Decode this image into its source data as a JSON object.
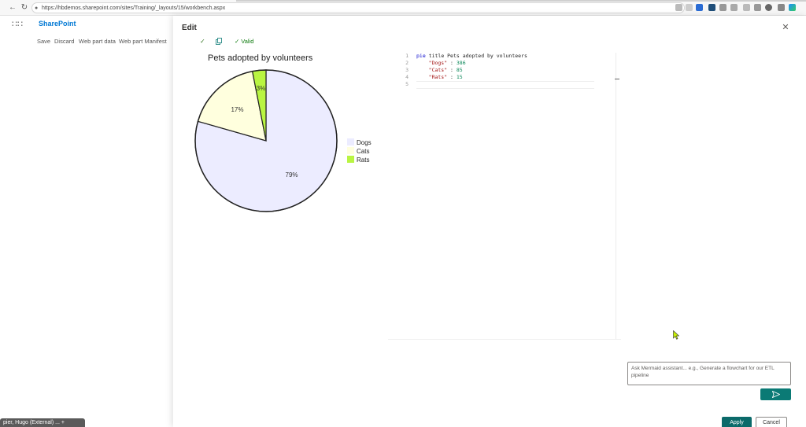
{
  "browser": {
    "url": "https://hbdemos.sharepoint.com/sites/Training/_layouts/15/workbench.aspx"
  },
  "sharepoint": {
    "brand": "SharePoint",
    "commands": [
      "Save",
      "Discard",
      "Web part data",
      "Web part Manifest"
    ],
    "taskbar_chip": "pier, Hugo (External)  ...  +"
  },
  "panel": {
    "title": "Edit",
    "valid_label": "Valid",
    "apply_label": "Apply",
    "cancel_label": "Cancel"
  },
  "editor": {
    "lines": [
      {
        "n": "1",
        "tokens": [
          {
            "t": "pie",
            "c": "kw"
          },
          {
            "t": " title Pets adopted by volunteers",
            "c": "plain"
          }
        ]
      },
      {
        "n": "2",
        "tokens": [
          {
            "t": "    ",
            "c": "plain"
          },
          {
            "t": "\"Dogs\"",
            "c": "str"
          },
          {
            "t": " : ",
            "c": "plain"
          },
          {
            "t": "386",
            "c": "num"
          }
        ]
      },
      {
        "n": "3",
        "tokens": [
          {
            "t": "    ",
            "c": "plain"
          },
          {
            "t": "\"Cats\"",
            "c": "str"
          },
          {
            "t": " : ",
            "c": "plain"
          },
          {
            "t": "85",
            "c": "num"
          }
        ]
      },
      {
        "n": "4",
        "tokens": [
          {
            "t": "    ",
            "c": "plain"
          },
          {
            "t": "\"Rats\"",
            "c": "str"
          },
          {
            "t": " : ",
            "c": "plain"
          },
          {
            "t": "15",
            "c": "num"
          }
        ]
      },
      {
        "n": "5",
        "tokens": []
      }
    ]
  },
  "assistant": {
    "placeholder": "Ask Mermaid assistant... e.g., Generate a flowchart for our ETL pipeline",
    "send_icon": "send-icon"
  },
  "chart_data": {
    "type": "pie",
    "title": "Pets adopted by volunteers",
    "categories": [
      "Dogs",
      "Cats",
      "Rats"
    ],
    "values": [
      386,
      85,
      15
    ],
    "percent_labels": [
      "79%",
      "17%",
      "3%"
    ],
    "colors": [
      "#ececff",
      "#ffffde",
      "#b9f542"
    ],
    "legend_position": "right"
  }
}
